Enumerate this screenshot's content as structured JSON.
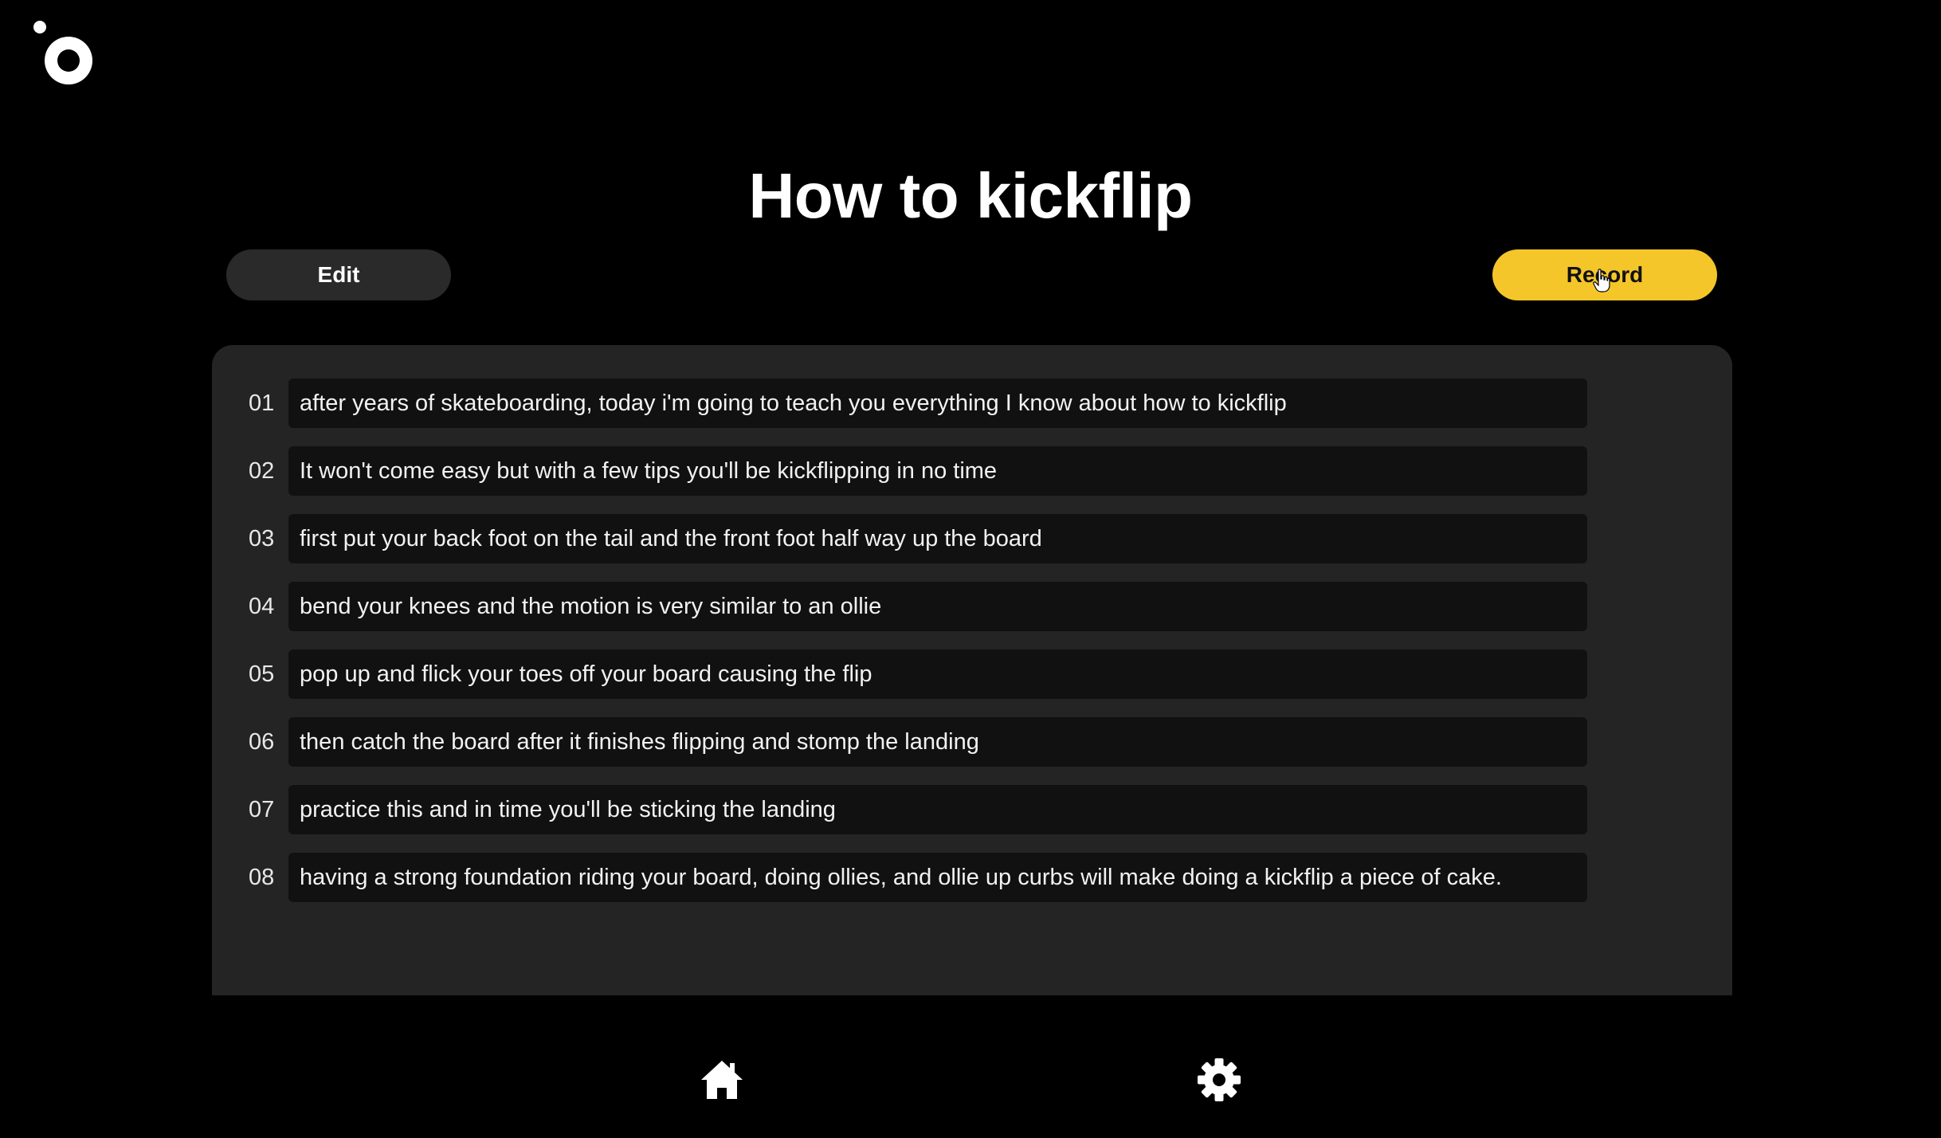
{
  "page": {
    "title": "How to kickflip"
  },
  "toolbar": {
    "edit_label": "Edit",
    "record_label": "Record"
  },
  "script": {
    "lines": [
      {
        "number": "01",
        "text": "after years of skateboarding, today i'm going to teach you everything I know about how to kickflip"
      },
      {
        "number": "02",
        "text": "It won't come easy but with a few tips you'll be kickflipping in no time"
      },
      {
        "number": "03",
        "text": "first put your back foot on the tail and the front foot half way up the board"
      },
      {
        "number": "04",
        "text": "bend your knees and the motion is very similar to an ollie"
      },
      {
        "number": "05",
        "text": "pop up and flick your toes off your board causing the flip"
      },
      {
        "number": "06",
        "text": "then catch the board after it finishes flipping and stomp the landing"
      },
      {
        "number": "07",
        "text": "practice this and in time you'll be sticking the landing"
      },
      {
        "number": "08",
        "text": "having a strong foundation riding your board, doing ollies, and ollie up curbs will make doing a kickflip a piece of cake."
      }
    ]
  },
  "nav": {
    "home_icon": "home-icon",
    "settings_icon": "gear-icon"
  },
  "colors": {
    "background": "#000000",
    "panel": "#242424",
    "row": "#111111",
    "accent": "#f5c629",
    "edit_button": "#2a2a2a"
  }
}
